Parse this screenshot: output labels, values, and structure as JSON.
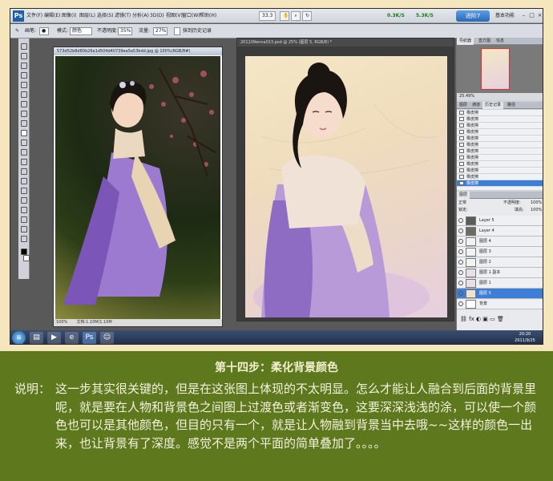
{
  "menubar": {
    "logo": "Ps",
    "items": [
      "文件(F)",
      "编辑(E)",
      "图像(I)",
      "图层(L)",
      "选择(S)",
      "滤镜(T)",
      "分析(A)",
      "3D(D)",
      "视图(V)",
      "窗口(W)",
      "帮助(H)"
    ],
    "zoom_chip": "33.3",
    "speed_up": "0.3K/S",
    "speed_down": "5.3K/S",
    "fast_button": "进阶7",
    "workspace": "基本功能"
  },
  "options_bar": {
    "brush_label": "画笔:",
    "mode_label": "模式:",
    "mode_value": "颜色",
    "opacity_label": "不透明度:",
    "opacity_value": "35%",
    "flow_label": "流量:",
    "flow_value": "27%",
    "history_label": "抹到历史记录"
  },
  "documents": {
    "left_title": "573d52b8d80b26a1d504d40739ea5a53bdd.jpg @ 100%(RGB/8#)",
    "left_status": "100%",
    "left_doc_info": "文档:1.10M/1.10M",
    "right_title": "201109enna013.psd @ 25% (图层 5, RGB/8) *",
    "right_status": "25%"
  },
  "panels": {
    "nav_tabs": [
      "导航器",
      "直方图",
      "信息"
    ],
    "nav_zoom": "25.49%",
    "hist_tabs": [
      "图层",
      "通道",
      "历史记录",
      "路径"
    ],
    "history_items": [
      "橡皮擦",
      "橡皮擦",
      "橡皮擦",
      "橡皮擦",
      "橡皮擦",
      "橡皮擦",
      "橡皮擦",
      "橡皮擦",
      "橡皮擦",
      "橡皮擦",
      "橡皮擦",
      "橡皮擦"
    ],
    "layers_tab": "图层",
    "blend_mode": "正常",
    "layer_opacity_label": "不透明度:",
    "layer_opacity": "100%",
    "lock_label": "锁定:",
    "fill_label": "填充:",
    "fill_value": "100%",
    "layers": [
      "Layer 5",
      "Layer 4",
      "图层 4",
      "图层 3",
      "图层 2",
      "图层 1 副本",
      "图层 1",
      "图层 5",
      "背景"
    ]
  },
  "taskbar": {
    "start": "⊞",
    "time": "20:20",
    "date": "2011/9/25"
  },
  "caption": {
    "title": "第十四步：柔化背景颜色",
    "label": "说明：",
    "text": "这一步其实很关键的，但是在这张图上体现的不太明显。怎么才能让人融合到后面的背景里呢，就是要在人物和背景色之间图上过渡色或者渐变色，这要深深浅浅的涂，可以使一个颜色也可以是其他颜色，但目的只有一个，就是让人物融到背景当中去哦~~这样的颜色一出来，也让背景有了深度。感觉不是两个平面的简单叠加了。。。。"
  },
  "colors": {
    "frame_bg": "#f5e6bd",
    "caption_bg": "#5d781d",
    "caption_text": "#f4f1de",
    "selection_blue": "#3d7fd6"
  }
}
